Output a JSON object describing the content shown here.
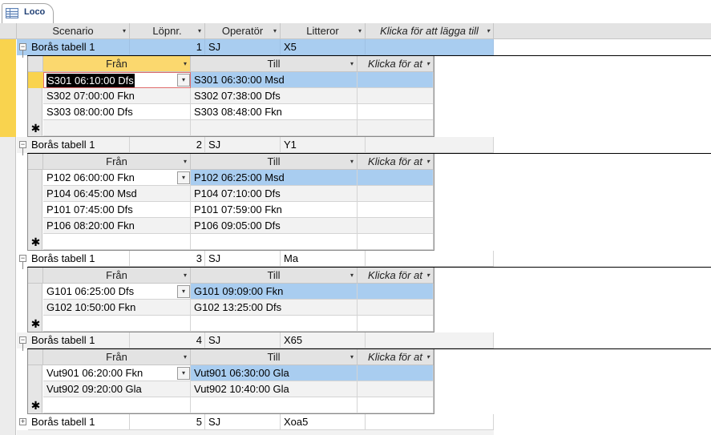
{
  "tab": {
    "label": "Loco"
  },
  "main_columns": [
    "Scenario",
    "Löpnr.",
    "Operatör",
    "Litteror",
    "Klicka för att lägga till"
  ],
  "sub_columns": [
    "Från",
    "Till",
    "Klicka för at"
  ],
  "records": [
    {
      "scenario": "Borås tabell 1",
      "lopnr": "1",
      "operator": "SJ",
      "litteror": "X5",
      "subrows": [
        {
          "fran": "S301 06:10:00 Dfs",
          "till": "S301 06:30:00 Msd"
        },
        {
          "fran": "S302 07:00:00 Fkn",
          "till": "S302 07:38:00 Dfs"
        },
        {
          "fran": "S303 08:00:00 Dfs",
          "till": "S303 08:48:00 Fkn"
        }
      ]
    },
    {
      "scenario": "Borås tabell 1",
      "lopnr": "2",
      "operator": "SJ",
      "litteror": "Y1",
      "subrows": [
        {
          "fran": "P102 06:00:00 Fkn",
          "till": "P102 06:25:00 Msd"
        },
        {
          "fran": "P104 06:45:00 Msd",
          "till": "P104 07:10:00 Dfs"
        },
        {
          "fran": "P101 07:45:00 Dfs",
          "till": "P101 07:59:00 Fkn"
        },
        {
          "fran": "P106 08:20:00 Fkn",
          "till": "P106 09:05:00 Dfs"
        }
      ]
    },
    {
      "scenario": "Borås tabell 1",
      "lopnr": "3",
      "operator": "SJ",
      "litteror": "Ma",
      "subrows": [
        {
          "fran": "G101 06:25:00 Dfs",
          "till": "G101 09:09:00 Fkn"
        },
        {
          "fran": "G102 10:50:00 Fkn",
          "till": "G102 13:25:00 Dfs"
        }
      ]
    },
    {
      "scenario": "Borås tabell 1",
      "lopnr": "4",
      "operator": "SJ",
      "litteror": "X65",
      "subrows": [
        {
          "fran": "Vut901 06:20:00 Fkn",
          "till": "Vut901 06:30:00 Gla"
        },
        {
          "fran": "Vut902 09:20:00 Gla",
          "till": "Vut902 10:40:00 Gla"
        }
      ]
    },
    {
      "scenario": "Borås tabell 1",
      "lopnr": "5",
      "operator": "SJ",
      "litteror": "Xoa5",
      "subrows": []
    }
  ],
  "glyphs": {
    "expanded": "⊟",
    "collapsed": "⊞",
    "new_row": "✱"
  },
  "colors": {
    "selection": "#a9cdf0",
    "current_column": "#f9d34e"
  }
}
